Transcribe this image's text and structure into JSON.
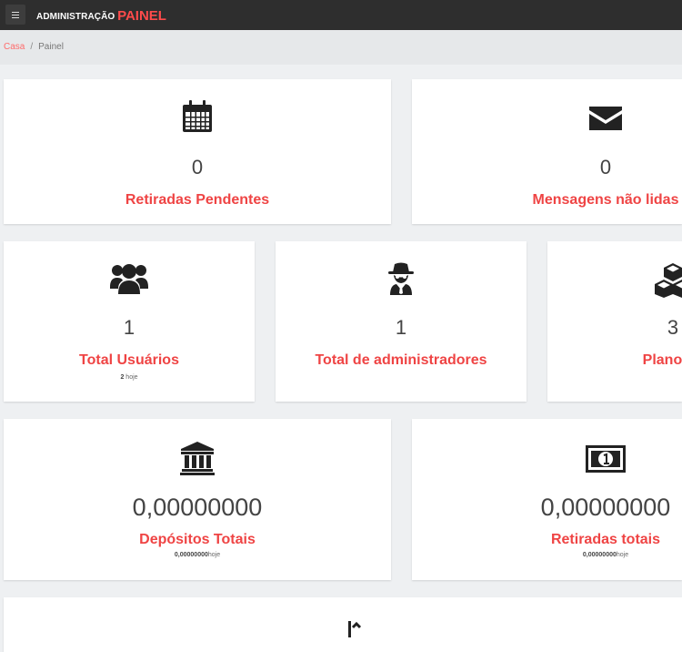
{
  "header": {
    "brand_sub": "ADMINISTRAÇÃO",
    "brand_main": "PAINEL",
    "menu_icon": "hamburger-icon"
  },
  "breadcrumb": {
    "home": "Casa",
    "separator": "/",
    "current": "Painel"
  },
  "colors": {
    "accent": "#ef4444",
    "topbar": "#2e2e2e",
    "background": "#eef0f2"
  },
  "cards": {
    "pending_withdrawals": {
      "icon": "calendar-icon",
      "value": "0",
      "label": "Retiradas Pendentes"
    },
    "unread_messages": {
      "icon": "envelope-icon",
      "value": "0",
      "label": "Mensagens não lidas"
    },
    "total_users": {
      "icon": "users-icon",
      "value": "1",
      "label": "Total Usuários",
      "sub_value": "2",
      "sub_text": " hoje"
    },
    "total_admins": {
      "icon": "spy-icon",
      "value": "1",
      "label": "Total de administradores"
    },
    "total_plans": {
      "icon": "cubes-icon",
      "value": "3",
      "label": "Planos T"
    },
    "total_deposits": {
      "icon": "bank-icon",
      "value": "0,00000000",
      "label": "Depósitos Totais",
      "sub_value": "0,00000000",
      "sub_text": "hoje"
    },
    "total_withdrawals": {
      "icon": "money-bill-icon",
      "value": "0,00000000",
      "label": "Retiradas totais",
      "sub_value": "0,00000000",
      "sub_text": "hoje"
    },
    "bottom_partial": {
      "icon": "chart-icon"
    }
  }
}
